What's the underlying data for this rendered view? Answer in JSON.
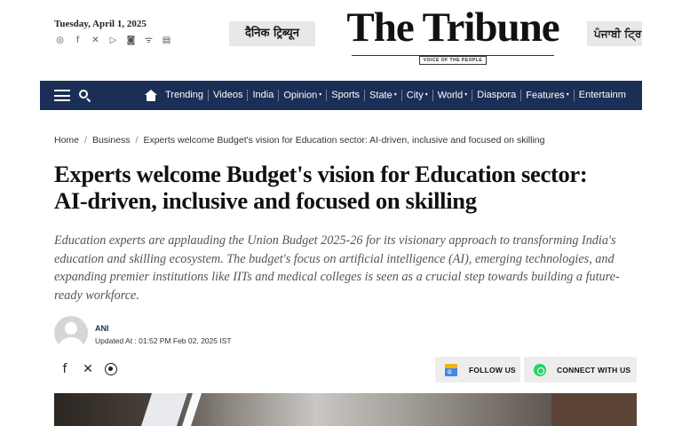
{
  "header": {
    "date": "Tuesday, April 1, 2025",
    "social_icons": [
      "whatsapp-icon",
      "facebook-icon",
      "x-icon",
      "youtube-icon",
      "instagram-icon",
      "rss-icon",
      "epaper-icon"
    ],
    "hindi_edition": "दैनिक ट्रिब्यून",
    "logo": "The Tribune",
    "tagline": "VOICE OF THE PEOPLE",
    "punjabi_edition": "ਪੰਜਾਬੀ ਟ੍ਰਿ"
  },
  "nav": {
    "items": [
      {
        "label": "Trending",
        "caret": ""
      },
      {
        "label": "Videos",
        "caret": ""
      },
      {
        "label": "India",
        "caret": ""
      },
      {
        "label": "Opinion",
        "caret": "▾"
      },
      {
        "label": "Sports",
        "caret": ""
      },
      {
        "label": "State",
        "caret": "▾"
      },
      {
        "label": "City",
        "caret": "▾"
      },
      {
        "label": "World",
        "caret": "▾"
      },
      {
        "label": "Diaspora",
        "caret": ""
      },
      {
        "label": "Features",
        "caret": "▾"
      },
      {
        "label": "Entertainm",
        "caret": ""
      }
    ]
  },
  "breadcrumb": {
    "home": "Home",
    "section": "Business",
    "current": "Experts welcome Budget's vision for Education sector: AI-driven, inclusive and focused on skilling",
    "separator": "/"
  },
  "article": {
    "headline": "Experts welcome Budget's vision for Education sector: AI-driven, inclusive and focused on skilling",
    "summary": "Education experts are applauding the Union Budget 2025-26 for its visionary approach to transforming India's education and skilling ecosystem. The budget's focus on artificial intelligence (AI), emerging technologies, and expanding premier institutions like IITs and medical colleges is seen as a crucial step towards building a future-ready workforce.",
    "author": "ANI",
    "updated": "Updated At : 01:52 PM Feb 02, 2025 IST"
  },
  "actions": {
    "follow_label": "FOLLOW US",
    "connect_label": "CONNECT WITH US"
  }
}
